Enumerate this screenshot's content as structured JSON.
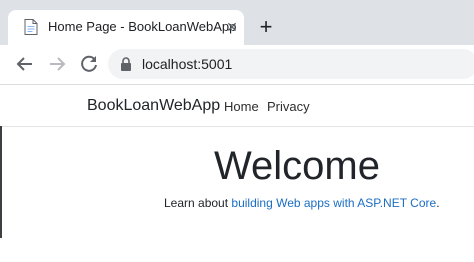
{
  "browser": {
    "tab": {
      "title": "Home Page - BookLoanWebApp",
      "close_icon": "close-icon",
      "favicon_icon": "page-icon"
    },
    "new_tab_icon": "plus-icon",
    "toolbar": {
      "back_icon": "back-arrow-icon",
      "forward_icon": "forward-arrow-icon",
      "reload_icon": "reload-icon",
      "lock_icon": "lock-icon",
      "url": "localhost:5001"
    }
  },
  "site": {
    "brand": "BookLoanWebApp",
    "nav": [
      {
        "label": "Home"
      },
      {
        "label": "Privacy"
      }
    ],
    "heading": "Welcome",
    "lead": {
      "prefix": "Learn about ",
      "link_text": "building Web apps with ASP.NET Core",
      "suffix": "."
    }
  },
  "colors": {
    "tabstrip": "#dee1e6",
    "omnibox": "#f1f3f4",
    "link": "#1b6ec2",
    "text": "#212529"
  }
}
